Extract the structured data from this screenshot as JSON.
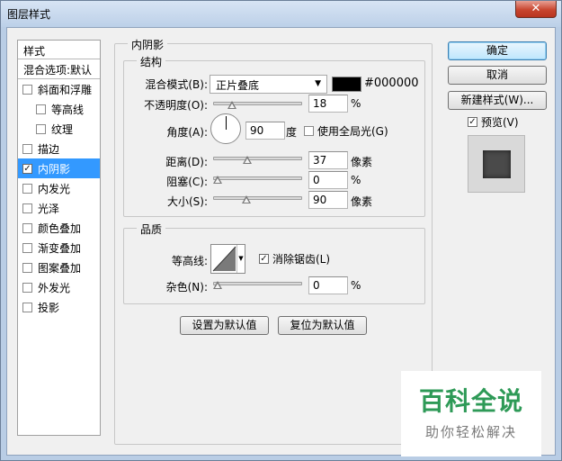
{
  "window": {
    "title": "图层样式",
    "close_glyph": "✕"
  },
  "sidebar": {
    "header": "样式",
    "blend_options": "混合选项:默认",
    "items": [
      {
        "label": "斜面和浮雕",
        "checked": false,
        "sub": false
      },
      {
        "label": "等高线",
        "checked": false,
        "sub": true
      },
      {
        "label": "纹理",
        "checked": false,
        "sub": true
      },
      {
        "label": "描边",
        "checked": false,
        "sub": false
      },
      {
        "label": "内阴影",
        "checked": true,
        "sub": false,
        "selected": true
      },
      {
        "label": "内发光",
        "checked": false,
        "sub": false
      },
      {
        "label": "光泽",
        "checked": false,
        "sub": false
      },
      {
        "label": "颜色叠加",
        "checked": false,
        "sub": false
      },
      {
        "label": "渐变叠加",
        "checked": false,
        "sub": false
      },
      {
        "label": "图案叠加",
        "checked": false,
        "sub": false
      },
      {
        "label": "外发光",
        "checked": false,
        "sub": false
      },
      {
        "label": "投影",
        "checked": false,
        "sub": false
      }
    ]
  },
  "panel": {
    "title": "内阴影",
    "structure": {
      "title": "结构",
      "blend_mode_label": "混合模式(B):",
      "blend_mode_value": "正片叠底",
      "color_hex": "#000000",
      "opacity_label": "不透明度(O):",
      "opacity_value": "18",
      "opacity_unit": "%",
      "angle_label": "角度(A):",
      "angle_value": "90",
      "angle_unit": "度",
      "global_light_label": "使用全局光(G)",
      "global_light_checked": false,
      "distance_label": "距离(D):",
      "distance_value": "37",
      "distance_unit": "像素",
      "choke_label": "阻塞(C):",
      "choke_value": "0",
      "choke_unit": "%",
      "size_label": "大小(S):",
      "size_value": "90",
      "size_unit": "像素"
    },
    "quality": {
      "title": "品质",
      "contour_label": "等高线:",
      "antialias_label": "消除锯齿(L)",
      "antialias_checked": true,
      "noise_label": "杂色(N):",
      "noise_value": "0",
      "noise_unit": "%"
    },
    "make_default_label": "设置为默认值",
    "reset_default_label": "复位为默认值"
  },
  "slider_levels": {
    "opacity": 0.18,
    "distance": 0.37,
    "choke": 0.0,
    "size": 0.36,
    "noise": 0.0
  },
  "buttons": {
    "ok": "确定",
    "cancel": "取消",
    "new_style": "新建样式(W)...",
    "preview": "预览(V)",
    "preview_checked": true
  },
  "watermark": {
    "title": "百科全说",
    "subtitle": "助你轻松解决"
  },
  "colors": {
    "selection": "#3399ff",
    "watermark_green": "#2e9a57",
    "shadow_color": "#000000"
  }
}
